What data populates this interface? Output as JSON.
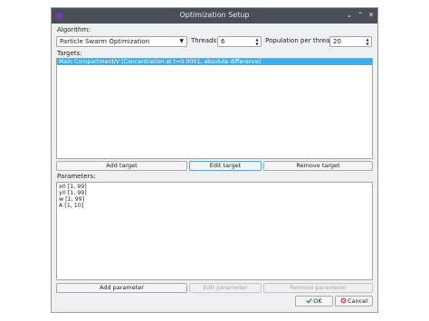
{
  "window": {
    "title": "Optimization Setup"
  },
  "algorithm": {
    "label": "Algorithm:",
    "selected": "Particle Swarm Optimization"
  },
  "threads": {
    "label": "Threads:",
    "value": "6"
  },
  "population": {
    "label": "Population per thread:",
    "value": "20"
  },
  "targets": {
    "label": "Targets:",
    "items": [
      "Main Compartment/V [Concentration at t=0.0001, absolute difference]"
    ],
    "add_label": "Add target",
    "edit_label": "Edit target",
    "remove_label": "Remove target"
  },
  "parameters": {
    "label": "Parameters:",
    "items": [
      "x0 [1, 99]",
      "y0 [1, 99]",
      "w [1, 99]",
      "A [1, 10]"
    ],
    "add_label": "Add parameter",
    "edit_label": "Edit parameter",
    "remove_label": "Remove parameter"
  },
  "dialog": {
    "ok_label": "OK",
    "cancel_label": "Cancel"
  },
  "colors": {
    "titlebar": "#4a4f55",
    "selection": "#3daee9",
    "window_bg": "#eff0f1"
  }
}
